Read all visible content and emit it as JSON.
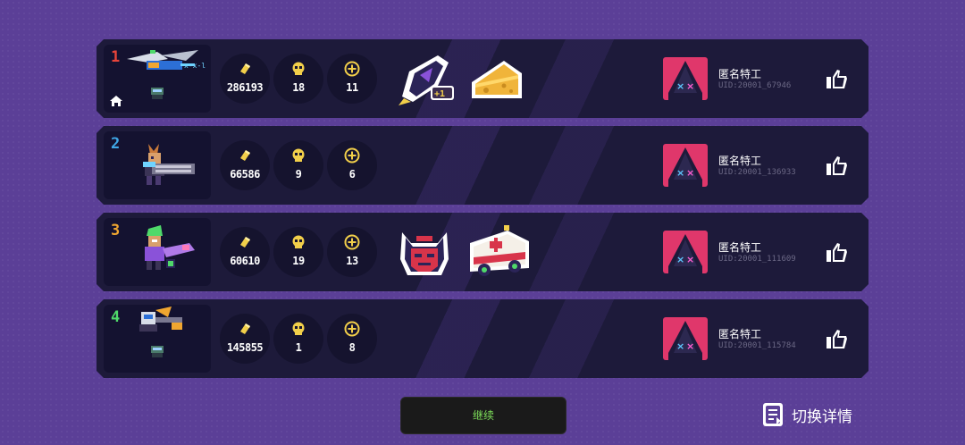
{
  "players": [
    {
      "rank": "1",
      "rank_color": "#e8443a",
      "coins": "286193",
      "kills": "18",
      "revives": "11",
      "name": "匿名特工",
      "uid": "UID:20001_67946",
      "has_home": true,
      "badges": [
        "rocket-plus-one-badge",
        "cheese-badge"
      ]
    },
    {
      "rank": "2",
      "rank_color": "#3fa7e6",
      "coins": "66586",
      "kills": "9",
      "revives": "6",
      "name": "匿名特工",
      "uid": "UID:20001_136933",
      "has_home": false,
      "badges": []
    },
    {
      "rank": "3",
      "rank_color": "#f0a630",
      "coins": "60610",
      "kills": "19",
      "revives": "13",
      "name": "匿名特工",
      "uid": "UID:20001_111609",
      "has_home": false,
      "badges": [
        "devil-face-badge",
        "ambulance-badge"
      ]
    },
    {
      "rank": "4",
      "rank_color": "#4fd96a",
      "coins": "145855",
      "kills": "1",
      "revives": "8",
      "name": "匿名特工",
      "uid": "UID:20001_115784",
      "has_home": false,
      "badges": []
    }
  ],
  "footer": {
    "continue_label": "继续",
    "detail_label": "切换详情"
  },
  "colors": {
    "background": "#5b3f97",
    "row": "#1d1a3a",
    "coin": "#f2cf4a",
    "accent_green": "#7ee05a",
    "avatar": "#e0376b"
  },
  "icons": {
    "coin": "gold-bar-icon",
    "kills": "skull-icon",
    "revives": "plus-coin-icon",
    "like": "thumbs-up-icon",
    "home": "home-icon",
    "detail": "document-toggle-icon"
  }
}
